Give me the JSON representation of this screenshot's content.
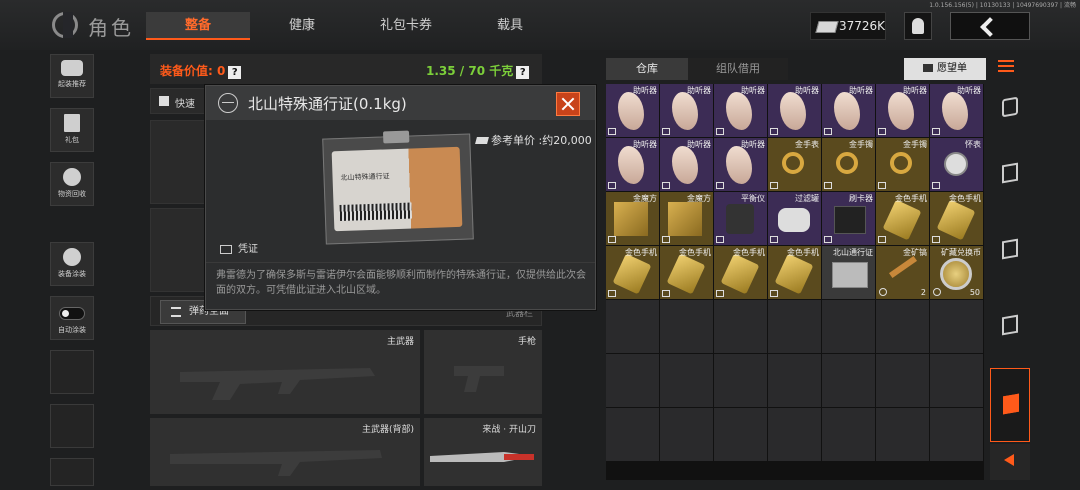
{
  "header": {
    "title": "角色",
    "tabs": [
      "整备",
      "健康",
      "礼包卡券",
      "载具"
    ],
    "active_tab": "整备",
    "version": "1.0.156.156(5) | 10130133 | 10497690397 | 流畅",
    "money": "37726K"
  },
  "left_sidebar": [
    "起装推荐",
    "礼包",
    "物资回收",
    "装备涂装",
    "自动涂装"
  ],
  "loadout": {
    "equip_value_label": "装备价值: 0",
    "weight": "1.35 / 70 千克",
    "help": "?",
    "quick_label": "快速",
    "ammo_button": "弹药全面",
    "weapon_bar": "武器栏",
    "slots": [
      "主武器",
      "手枪",
      "主武器(背部)",
      "来战 · 开山刀"
    ]
  },
  "popup": {
    "title": "北山特殊通行证(0.1kg)",
    "ref_price": "参考单价 :约20,000",
    "card_text": "北山特殊通行证",
    "category": "凭证",
    "description": "弗雷德为了确保多斯与雷诺伊尔会面能够顺利而制作的特殊通行证，仅提供给此次会面的双方。可凭借此证进入北山区域。"
  },
  "stash": {
    "tabs": [
      "仓库",
      "组队借用"
    ],
    "active_tab": "仓库",
    "wishlist": "愿望单",
    "items": [
      {
        "name": "助听器",
        "type": "hearing",
        "color": "purple",
        "tag": true
      },
      {
        "name": "助听器",
        "type": "hearing",
        "color": "purple",
        "tag": true
      },
      {
        "name": "助听器",
        "type": "hearing",
        "color": "purple",
        "tag": true
      },
      {
        "name": "助听器",
        "type": "hearing",
        "color": "purple",
        "tag": true
      },
      {
        "name": "助听器",
        "type": "hearing",
        "color": "purple",
        "tag": true
      },
      {
        "name": "助听器",
        "type": "hearing",
        "color": "purple",
        "tag": true
      },
      {
        "name": "助听器",
        "type": "hearing",
        "color": "purple",
        "tag": true
      },
      {
        "name": "助听器",
        "type": "hearing",
        "color": "purple",
        "tag": true
      },
      {
        "name": "助听器",
        "type": "hearing",
        "color": "purple",
        "tag": true
      },
      {
        "name": "助听器",
        "type": "hearing",
        "color": "purple",
        "tag": true
      },
      {
        "name": "金手表",
        "type": "ring",
        "color": "gold",
        "tag": true
      },
      {
        "name": "金手镯",
        "type": "ring",
        "color": "gold",
        "tag": true
      },
      {
        "name": "金手镯",
        "type": "ring",
        "color": "gold",
        "tag": true
      },
      {
        "name": "怀表",
        "type": "watch",
        "color": "purple",
        "tag": true
      },
      {
        "name": "金魔方",
        "type": "goldbox",
        "color": "gold",
        "tag": true
      },
      {
        "name": "金魔方",
        "type": "goldbox",
        "color": "gold",
        "tag": true
      },
      {
        "name": "平衡仪",
        "type": "device",
        "color": "purple",
        "tag": true
      },
      {
        "name": "过滤罐",
        "type": "filter",
        "color": "purple",
        "tag": true
      },
      {
        "name": "刷卡器",
        "type": "reader",
        "color": "purple",
        "tag": true
      },
      {
        "name": "金色手机",
        "type": "goldphone",
        "color": "gold",
        "tag": true
      },
      {
        "name": "金色手机",
        "type": "goldphone",
        "color": "gold",
        "tag": true
      },
      {
        "name": "金色手机",
        "type": "goldphone",
        "color": "gold",
        "tag": true
      },
      {
        "name": "金色手机",
        "type": "goldphone",
        "color": "gold",
        "tag": true
      },
      {
        "name": "金色手机",
        "type": "goldphone",
        "color": "gold",
        "tag": true
      },
      {
        "name": "金色手机",
        "type": "goldphone",
        "color": "gold",
        "tag": true
      },
      {
        "name": "北山通行证",
        "type": "pass",
        "color": "gray",
        "tag": false
      },
      {
        "name": "金矿镐",
        "type": "pickaxe",
        "color": "gold",
        "count": "2",
        "clock": true
      },
      {
        "name": "矿藏兑换币",
        "type": "coin",
        "color": "gold",
        "count": "50",
        "clock": true
      }
    ],
    "total_cells": 49
  }
}
